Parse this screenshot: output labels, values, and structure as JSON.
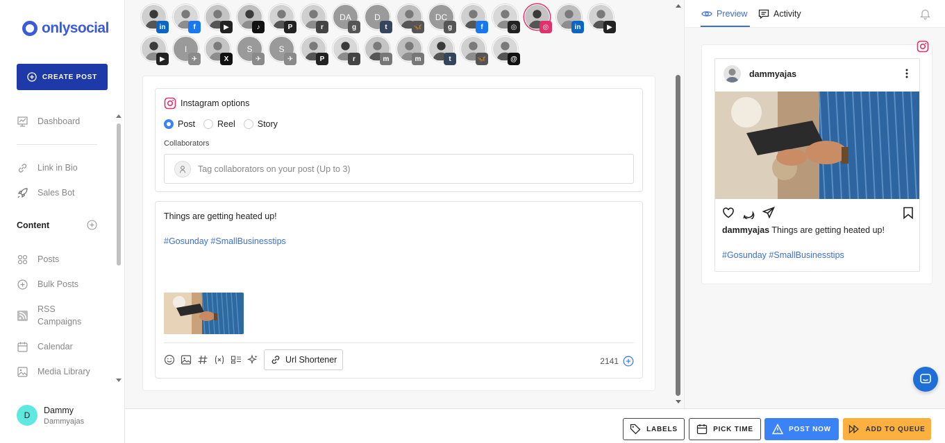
{
  "brand": {
    "name": "onlysocial",
    "accent": "#3b5bdb"
  },
  "sidebar": {
    "create_label": "CREATE POST",
    "items_top": [
      {
        "label": "Dashboard",
        "icon": "chart-icon"
      }
    ],
    "items_tools": [
      {
        "label": "Link in Bio",
        "icon": "link-icon"
      },
      {
        "label": "Sales Bot",
        "icon": "rocket-icon"
      }
    ],
    "content_heading": "Content",
    "items_content": [
      {
        "label": "Posts",
        "icon": "grid-icon"
      },
      {
        "label": "Bulk Posts",
        "icon": "plus-circle-icon"
      },
      {
        "label": "RSS",
        "label2": "Campaigns",
        "icon": "rss-icon"
      },
      {
        "label": "Calendar",
        "icon": "calendar-icon"
      },
      {
        "label": "Media Library",
        "icon": "image-icon"
      }
    ],
    "user": {
      "initial": "D",
      "name": "Dammy",
      "handle": "Dammyajas"
    }
  },
  "accounts": [
    {
      "badge": "in",
      "net": "linkedin",
      "color": "#0a66c2"
    },
    {
      "badge": "f",
      "net": "facebook",
      "color": "#1877f2"
    },
    {
      "badge": "▶",
      "net": "youtube",
      "color": "#222"
    },
    {
      "badge": "♪",
      "net": "tiktok",
      "color": "#111"
    },
    {
      "badge": "P",
      "net": "pinterest",
      "color": "#222"
    },
    {
      "badge": "r",
      "net": "reddit",
      "color": "#444"
    },
    {
      "initials": "DA",
      "badge": "g",
      "net": "gbp",
      "color": "#555"
    },
    {
      "initials": "D",
      "badge": "t",
      "net": "tumblr",
      "color": "#35465c"
    },
    {
      "badge": "🦋",
      "net": "bluesky",
      "color": "#555"
    },
    {
      "initials": "DC",
      "badge": "g",
      "net": "gbp",
      "color": "#555"
    },
    {
      "badge": "f",
      "net": "facebook",
      "color": "#1877f2"
    },
    {
      "badge": "◎",
      "net": "instagram",
      "color": "#222"
    },
    {
      "badge": "◎",
      "net": "instagram",
      "color": "#e1306c",
      "selected": true
    },
    {
      "badge": "in",
      "net": "linkedin",
      "color": "#0a66c2"
    },
    {
      "badge": "▶",
      "net": "youtube",
      "color": "#222"
    },
    {
      "badge": "▶",
      "net": "youtube",
      "color": "#222"
    },
    {
      "initials": "I",
      "badge": "✈",
      "net": "telegram",
      "color": "#8a8a8a"
    },
    {
      "badge": "X",
      "net": "x",
      "color": "#111"
    },
    {
      "initials": "S",
      "badge": "✈",
      "net": "telegram",
      "color": "#8a8a8a"
    },
    {
      "initials": "S",
      "badge": "✈",
      "net": "telegram",
      "color": "#8a8a8a"
    },
    {
      "badge": "P",
      "net": "pinterest",
      "color": "#222"
    },
    {
      "badge": "r",
      "net": "reddit",
      "color": "#444"
    },
    {
      "badge": "m",
      "net": "mastodon",
      "color": "#777"
    },
    {
      "badge": "m",
      "net": "mastodon",
      "color": "#777"
    },
    {
      "badge": "t",
      "net": "tumblr",
      "color": "#35465c"
    },
    {
      "badge": "🦋",
      "net": "bluesky",
      "color": "#555"
    },
    {
      "badge": "@",
      "net": "threads",
      "color": "#111"
    }
  ],
  "instagram_options": {
    "title": "Instagram options",
    "types": [
      "Post",
      "Reel",
      "Story"
    ],
    "selected": "Post",
    "collab_label": "Collaborators",
    "collab_placeholder": "Tag collaborators on your post (Up to 3)"
  },
  "editor": {
    "text": "Things are getting heated up!",
    "hashtags": "#Gosunday #SmallBusinesstips",
    "url_shortener": "Url Shortener",
    "char_count": "2141"
  },
  "preview": {
    "tab_preview": "Preview",
    "tab_activity": "Activity",
    "username": "dammyajas",
    "caption": "Things are getting heated up!",
    "hashtags": "#Gosunday #SmallBusinesstips"
  },
  "actions": {
    "labels": "LABELS",
    "pick_time": "PICK TIME",
    "post_now": "POST NOW",
    "add_queue": "ADD TO QUEUE"
  }
}
